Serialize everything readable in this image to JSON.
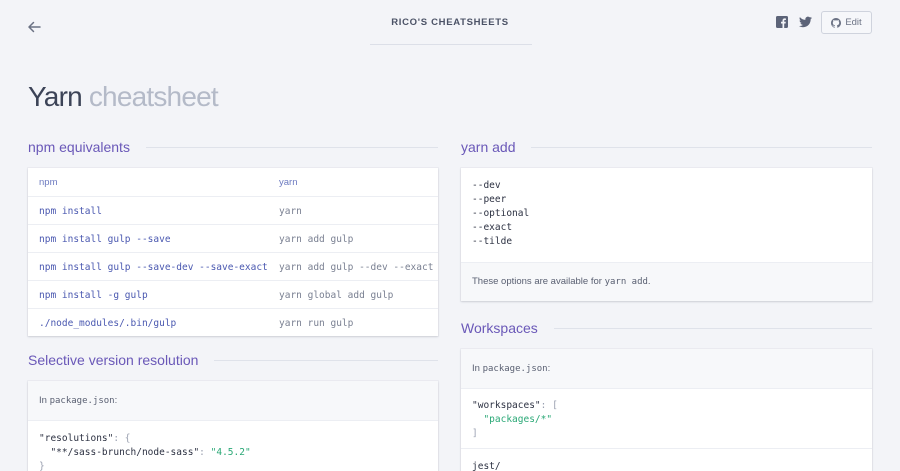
{
  "header": {
    "site_title": "RICO'S CHEATSHEETS",
    "edit_label": "Edit",
    "back_icon": "arrow-left-icon",
    "social_icons": [
      "facebook-icon",
      "twitter-icon"
    ]
  },
  "page": {
    "title_main": "Yarn",
    "title_sub": "cheatsheet"
  },
  "npm_equivalents": {
    "heading": "npm equivalents",
    "columns": [
      "npm",
      "yarn"
    ],
    "rows": [
      [
        "npm install",
        "yarn"
      ],
      [
        "npm install gulp --save",
        "yarn add gulp"
      ],
      [
        "npm install gulp --save-dev --save-exact",
        "yarn add gulp --dev --exact"
      ],
      [
        "npm install -g gulp",
        "yarn global add gulp"
      ],
      [
        "./node_modules/.bin/gulp",
        "yarn run gulp"
      ]
    ]
  },
  "yarn_add": {
    "heading": "yarn add",
    "options": [
      "--dev",
      "--peer",
      "--optional",
      "--exact",
      "--tilde"
    ],
    "note_prefix": "These options are available for ",
    "note_code": "yarn add",
    "note_suffix": "."
  },
  "selective": {
    "heading": "Selective version resolution",
    "intro_prefix": "In ",
    "intro_code": "package.json",
    "intro_suffix": ":",
    "code_key": "\"resolutions\"",
    "code_colon": ": {",
    "code_inner_key": "\"**/sass-brunch/node-sass\"",
    "code_inner_colon": ": ",
    "code_inner_value": "\"4.5.2\"",
    "code_close": "}"
  },
  "workspaces": {
    "heading": "Workspaces",
    "intro_prefix": "In ",
    "intro_code": "package.json",
    "intro_suffix": ":",
    "code_key": "\"workspaces\"",
    "code_colon": ": [",
    "code_item": "\"packages/*\"",
    "code_close": "]",
    "next_line": "jest/"
  },
  "colors": {
    "background": "#f3f4f8",
    "accent": "#6a58b8",
    "string": "#2aa876"
  }
}
